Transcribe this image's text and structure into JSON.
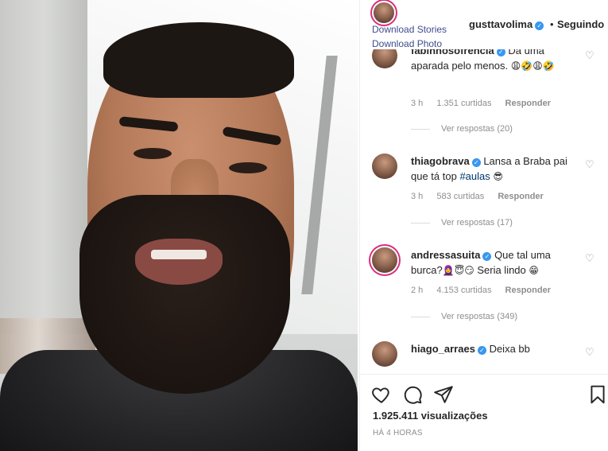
{
  "header": {
    "username": "gusttavolima",
    "separator": "•",
    "follow_status": "Seguindo",
    "download_stories": "Download Stories",
    "download_photo": "Download Photo"
  },
  "comments": [
    {
      "username": "fabinnosofrencia",
      "text": "Da uma aparada pelo menos.",
      "emoji": "😩🤣😩🤣",
      "time": "3 h",
      "likes": "1.351 curtidas",
      "reply_label": "Responder",
      "view_replies": "Ver respostas (20)"
    },
    {
      "username": "thiagobrava",
      "text": "Lansa a Braba pai que tá top",
      "hashtag": "#aulas",
      "emoji": "😎",
      "time": "3 h",
      "likes": "583 curtidas",
      "reply_label": "Responder",
      "view_replies": "Ver respostas (17)"
    },
    {
      "username": "andressasuita",
      "text": "Que tal uma burca?",
      "emoji_a": "🧕😇😏",
      "text_b": "Seria lindo",
      "emoji_b": "😁",
      "time": "2 h",
      "likes": "4.153 curtidas",
      "reply_label": "Responder",
      "view_replies": "Ver respostas (349)"
    },
    {
      "username": "hiago_arraes",
      "text": "Deixa bb"
    }
  ],
  "footer": {
    "views": "1.925.411 visualizações",
    "time_ago": "HÁ 4 HORAS"
  },
  "icons": {
    "verified": "✓",
    "heart": "♡"
  },
  "colors": {
    "verified": "#3897f0",
    "link": "#3e4d8e",
    "muted": "#8e8e8e",
    "hashtag": "#00376b"
  }
}
